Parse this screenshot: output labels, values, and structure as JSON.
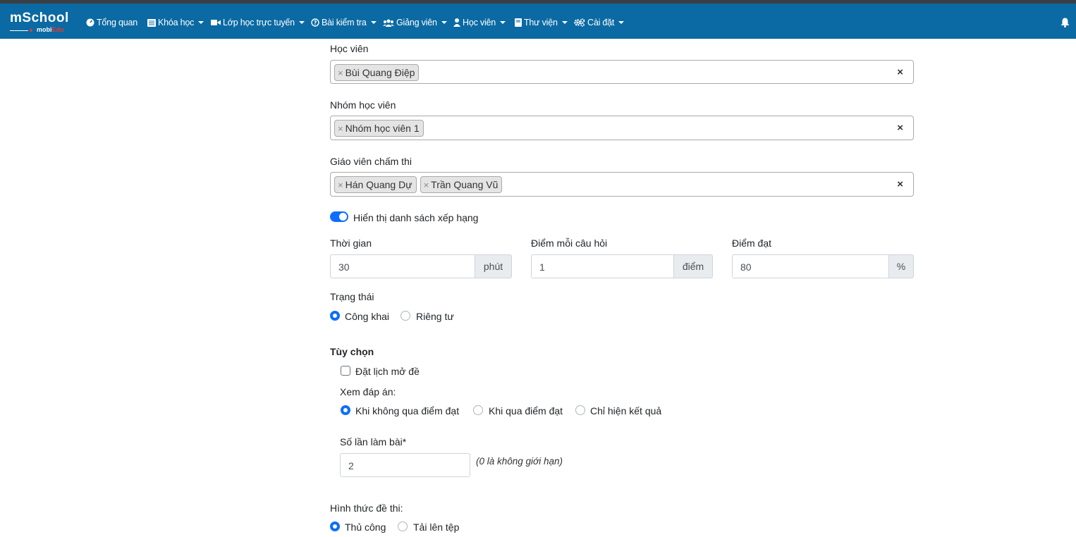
{
  "brand": {
    "main": "mSchool",
    "sub_a": "mobi",
    "sub_b": "Edu"
  },
  "nav": {
    "items": [
      {
        "label": "Tổng quan",
        "icon": "dashboard-icon",
        "caret": false
      },
      {
        "label": "Khóa học",
        "icon": "list-icon",
        "caret": true
      },
      {
        "label": "Lớp học trực tuyến",
        "icon": "video-camera-icon",
        "caret": true
      },
      {
        "label": "Bài kiểm tra",
        "icon": "question-circle-icon",
        "caret": true
      },
      {
        "label": "Giảng viên",
        "icon": "users-icon",
        "caret": true
      },
      {
        "label": "Học viên",
        "icon": "user-icon",
        "caret": true
      },
      {
        "label": "Thư viện",
        "icon": "book-icon",
        "caret": true
      },
      {
        "label": "Cài đặt",
        "icon": "cogs-icon",
        "caret": true
      }
    ],
    "bell_icon": "bell-icon"
  },
  "form": {
    "students": {
      "label": "Học viên",
      "tags": [
        "Bùi Quang Điệp"
      ],
      "clear": "×"
    },
    "student_groups": {
      "label": "Nhóm học viên",
      "tags": [
        "Nhóm học viên 1"
      ],
      "clear": "×"
    },
    "graders": {
      "label": "Giáo viên chấm thi",
      "tags": [
        "Hán Quang Dự",
        "Trần Quang Vũ"
      ],
      "clear": "×"
    },
    "tag_remove": "×",
    "ranking": {
      "label": "Hiển thị danh sách xếp hạng",
      "on": true
    },
    "duration": {
      "label": "Thời gian",
      "value": "30",
      "unit": "phút"
    },
    "points_per_question": {
      "label": "Điểm mỗi câu hỏi",
      "value": "1",
      "unit": "điểm"
    },
    "pass_score": {
      "label": "Điểm đạt",
      "value": "80",
      "unit": "%"
    },
    "status": {
      "label": "Trạng thái",
      "options": [
        "Công khai",
        "Riêng tư"
      ],
      "selected": "Công khai"
    },
    "options_title": "Tùy chọn",
    "schedule": {
      "label": "Đặt lịch mở đề",
      "checked": false
    },
    "view_answers": {
      "label": "Xem đáp án:",
      "options": [
        "Khi không qua điểm đạt",
        "Khi qua điểm đạt",
        "Chỉ hiện kết quả"
      ],
      "selected": "Khi không qua điểm đạt"
    },
    "attempts": {
      "label": "Số lần làm bài*",
      "value": "2",
      "hint": "(0 là không giới hạn)"
    },
    "exam_format": {
      "label": "Hình thức đề thi:",
      "options": [
        "Thủ công",
        "Tải lên tệp"
      ],
      "selected": "Thủ công"
    }
  },
  "colors": {
    "navbar": "#0b6aa3",
    "accent": "#0d6efd",
    "logo_red": "#e53935"
  }
}
